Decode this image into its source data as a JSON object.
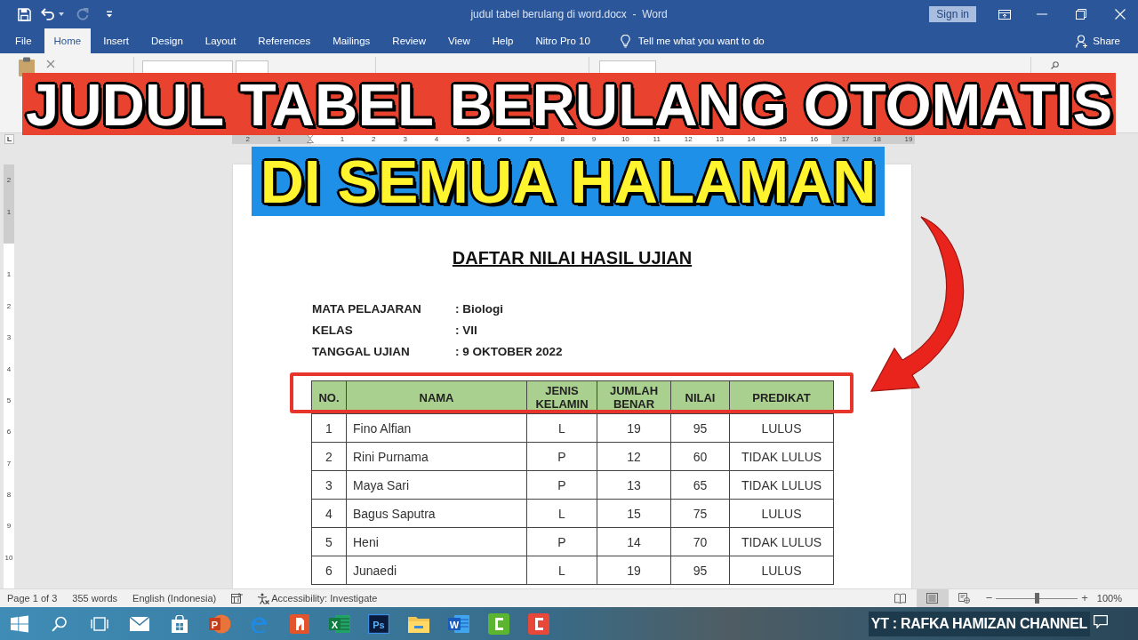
{
  "title_bar": {
    "quick_access": [
      {
        "kind": "save",
        "disabled": false
      },
      {
        "kind": "undo",
        "disabled": false
      },
      {
        "kind": "redo",
        "disabled": true
      },
      {
        "kind": "customize",
        "disabled": false
      }
    ],
    "document_title": "judul tabel berulang di word.docx  -  Word",
    "sign_in": "Sign in"
  },
  "ribbon_tabs": [
    {
      "label": "File",
      "selected": false
    },
    {
      "label": "Home",
      "selected": true
    },
    {
      "label": "Insert",
      "selected": false
    },
    {
      "label": "Design",
      "selected": false
    },
    {
      "label": "Layout",
      "selected": false
    },
    {
      "label": "References",
      "selected": false
    },
    {
      "label": "Mailings",
      "selected": false
    },
    {
      "label": "Review",
      "selected": false
    },
    {
      "label": "View",
      "selected": false
    },
    {
      "label": "Help",
      "selected": false
    },
    {
      "label": "Nitro Pro 10",
      "selected": false
    }
  ],
  "tell_me": {
    "placeholder": "Tell me what you want to do"
  },
  "share": "Share",
  "overlay_banners": [
    {
      "kind": "headline",
      "text": "JUDUL TABEL BERULANG OTOMATIS"
    },
    {
      "kind": "subheadline",
      "text": "DI SEMUA HALAMAN"
    }
  ],
  "ruler": {
    "left_marks": [
      "2",
      "1"
    ],
    "marks": [
      "1",
      "2",
      "3",
      "4",
      "5",
      "6",
      "7",
      "8",
      "9",
      "10",
      "11",
      "12",
      "13",
      "14",
      "15",
      "16",
      "17",
      "18",
      "19"
    ],
    "vertical_top_marks": [
      "2",
      "1"
    ],
    "vertical_marks": [
      "1",
      "2",
      "3",
      "4",
      "5",
      "6",
      "7",
      "8",
      "9",
      "10"
    ]
  },
  "document": {
    "title": "DAFTAR NILAI HASIL UJIAN",
    "info": [
      {
        "label": "MATA PELAJARAN",
        "value": ": Biologi"
      },
      {
        "label": "KELAS",
        "value": ": VII"
      },
      {
        "label": "TANGGAL UJIAN",
        "value": ": 9 OKTOBER 2022"
      }
    ],
    "table": {
      "columns": [
        "NO.",
        "NAMA",
        "JENIS KELAMIN",
        "JUMLAH BENAR",
        "NILAI",
        "PREDIKAT"
      ],
      "rows": [
        [
          "1",
          "Fino Alfian",
          "L",
          "19",
          "95",
          "LULUS"
        ],
        [
          "2",
          "Rini Purnama",
          "P",
          "12",
          "60",
          "TIDAK LULUS"
        ],
        [
          "3",
          "Maya Sari",
          "P",
          "13",
          "65",
          "TIDAK LULUS"
        ],
        [
          "4",
          "Bagus Saputra",
          "L",
          "15",
          "75",
          "LULUS"
        ],
        [
          "5",
          "Heni",
          "P",
          "14",
          "70",
          "TIDAK LULUS"
        ],
        [
          "6",
          "Junaedi",
          "L",
          "19",
          "95",
          "LULUS"
        ]
      ]
    }
  },
  "status_bar": {
    "page": "Page 1 of 3",
    "words": "355 words",
    "language": "English (Indonesia)",
    "accessibility": "Accessibility: Investigate",
    "views": [
      {
        "kind": "read_mode",
        "selected": false
      },
      {
        "kind": "print_layout",
        "selected": true
      },
      {
        "kind": "web_layout",
        "selected": false
      }
    ],
    "zoom": {
      "minus": "−",
      "plus": "+",
      "level": 0.5,
      "value": "100%"
    }
  },
  "taskbar": {
    "apps": [
      {
        "kind": "start"
      },
      {
        "kind": "search"
      },
      {
        "kind": "task_view"
      },
      {
        "kind": "mail"
      },
      {
        "kind": "store"
      },
      {
        "kind": "powerpoint",
        "glyph": "P"
      },
      {
        "kind": "edge"
      },
      {
        "kind": "nitro"
      },
      {
        "kind": "excel",
        "glyph": "X"
      },
      {
        "kind": "photoshop",
        "glyph": "Ps"
      },
      {
        "kind": "explorer"
      },
      {
        "kind": "word",
        "glyph": "W"
      },
      {
        "kind": "camtasia"
      },
      {
        "kind": "camrec"
      }
    ],
    "channel_label": "YT : RAFKA HAMIZAN CHANNEL"
  }
}
